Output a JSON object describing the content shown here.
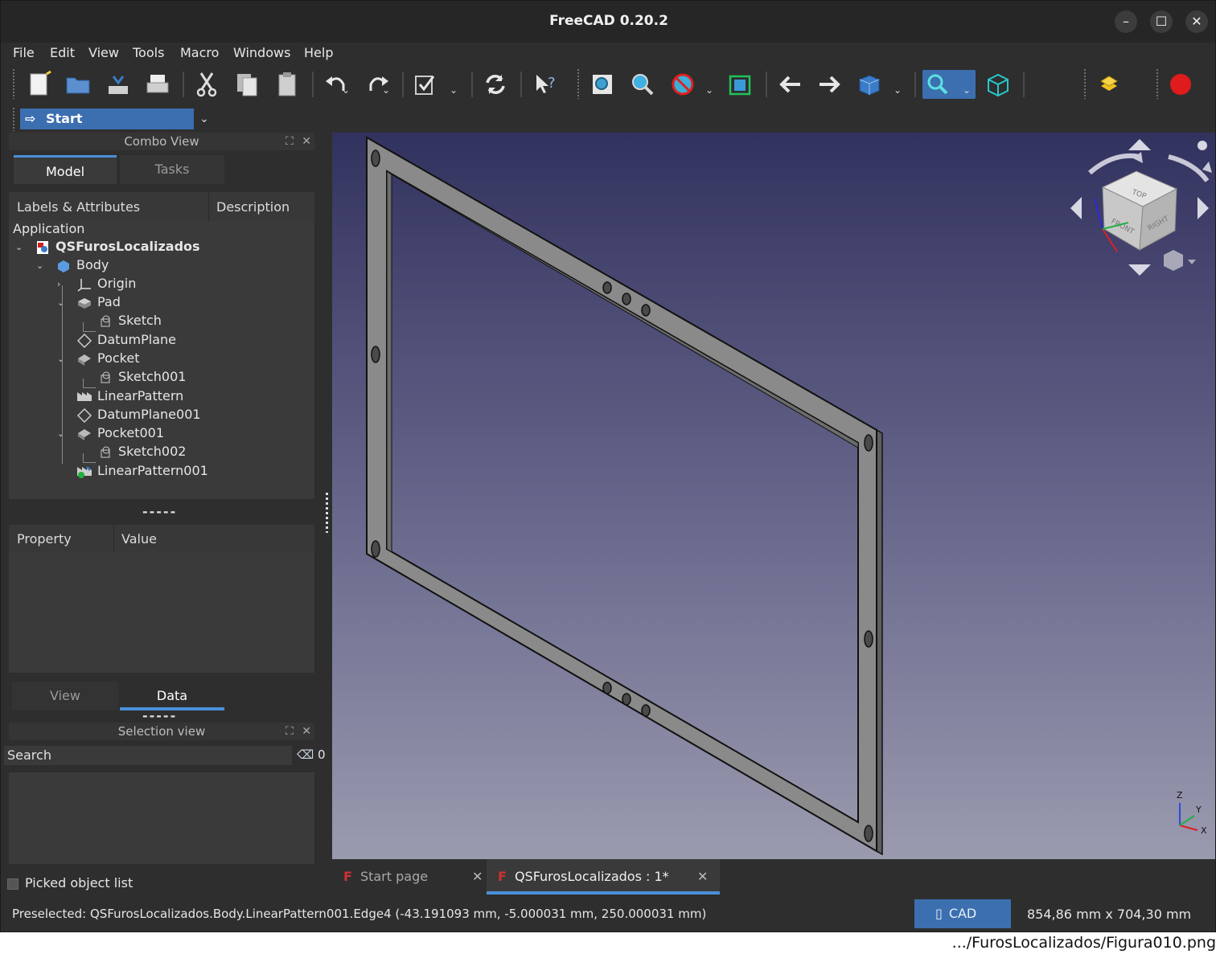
{
  "window": {
    "title": "FreeCAD 0.20.2"
  },
  "menu": {
    "file": "File",
    "edit": "Edit",
    "view": "View",
    "tools": "Tools",
    "macro": "Macro",
    "windows": "Windows",
    "help": "Help"
  },
  "toolbar": {
    "icons": [
      "new-document-icon",
      "open-folder-icon",
      "save-icon",
      "print-icon",
      "cut-icon",
      "copy-icon",
      "paste-icon",
      "undo-icon",
      "redo-icon",
      "refresh-icon",
      "recompute-icon",
      "whats-this-icon",
      "fit-all-icon",
      "fit-selection-icon",
      "draw-style-icon",
      "bounding-box-icon",
      "back-icon",
      "forward-icon",
      "std-views-icon",
      "measure-icon",
      "isometric-cube-icon",
      "macro-icon",
      "record-macro-icon"
    ],
    "accent": "#3b6fb0",
    "record_color": "#e01b1b"
  },
  "workbench": {
    "label": "Start"
  },
  "combo_view": {
    "title": "Combo View",
    "tabs": {
      "model": "Model",
      "tasks": "Tasks"
    },
    "tree_header": {
      "labels": "Labels & Attributes",
      "description": "Description"
    },
    "tree": {
      "root": "Application",
      "document": "QSFurosLocalizados",
      "items": [
        "Body",
        "Origin",
        "Pad",
        "Sketch",
        "DatumPlane",
        "Pocket",
        "Sketch001",
        "LinearPattern",
        "DatumPlane001",
        "Pocket001",
        "Sketch002",
        "LinearPattern001"
      ]
    },
    "separator": "-----",
    "property_header": {
      "property": "Property",
      "value": "Value"
    },
    "bottom_tabs": {
      "view": "View",
      "data": "Data"
    },
    "separator2": "-----"
  },
  "selection_view": {
    "title": "Selection view",
    "search_placeholder": "Search",
    "count": "0",
    "picked_label": "Picked object list"
  },
  "doc_tabs": {
    "start": "Start page",
    "doc": "QSFurosLocalizados : 1*"
  },
  "status": {
    "preselected": "Preselected: QSFurosLocalizados.Body.LinearPattern001.Edge4 (-43.191093 mm, -5.000031 mm, 250.000031 mm)",
    "nav_style": "CAD",
    "dimensions": "854,86 mm x 704,30 mm"
  },
  "nav_cube": {
    "front": "FRONT",
    "right": "RIGHT",
    "top": "TOP"
  },
  "axis": {
    "x": "X",
    "y": "Y",
    "z": "Z"
  },
  "footer": {
    "path": ".../FurosLocalizados/Figura010.png"
  }
}
